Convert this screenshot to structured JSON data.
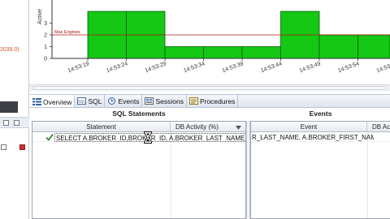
{
  "left_panel": {
    "cut_text": "2039.0)"
  },
  "chart": {
    "y_axis_label": "Active",
    "max_label": "Max Engines",
    "y_ticks": [
      "3",
      "2",
      "1",
      "0"
    ],
    "x_ticks": [
      "14:53:19",
      "14:53:24",
      "14:53:29",
      "14:53:34",
      "14:53:39",
      "14:53:44",
      "14:53:49",
      "14:53:54",
      "14:53:59"
    ],
    "bar_color": "#14c814",
    "max_line_color": "#b01010"
  },
  "chart_data": {
    "type": "area",
    "x": [
      "14:53:19",
      "14:53:24",
      "14:53:29",
      "14:53:34",
      "14:53:39",
      "14:53:44",
      "14:53:49",
      "14:53:54",
      "14:53:59"
    ],
    "series": [
      {
        "values": [
          0,
          4,
          4,
          1,
          1,
          1,
          4,
          2,
          2
        ]
      }
    ],
    "max_engines": 2,
    "ylim": [
      0,
      4
    ],
    "grid": false
  },
  "tabs": [
    {
      "label": "Overview",
      "icon": "overview-icon",
      "active": true
    },
    {
      "label": "SQL",
      "icon": "sql-icon",
      "active": false
    },
    {
      "label": "Events",
      "icon": "clock-icon",
      "active": false
    },
    {
      "label": "Sessions",
      "icon": "sessions-icon",
      "active": false
    },
    {
      "label": "Procedures",
      "icon": "procedures-icon",
      "active": false
    }
  ],
  "sql_statements": {
    "title": "SQL Statements",
    "columns": [
      "Statement",
      "DB Activity (%)"
    ],
    "rows": [
      {
        "statement": "SELECT A.BROKER_ID,BROKER_ID, A.BROKER_LAST_NAME, BROKER_FIRST_NAME"
      }
    ]
  },
  "events": {
    "title": "Events",
    "columns": [
      "Event",
      "DB Ac"
    ],
    "rows": [
      {
        "event": "R_LAST_NAME, A.BROKER_FIRST_NAME BROKER_FIRST_NAME"
      }
    ]
  }
}
